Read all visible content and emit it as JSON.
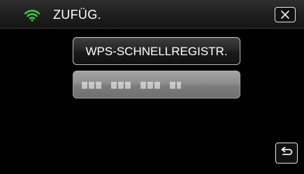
{
  "header": {
    "title": "ZUFÜG.",
    "wifi_icon": "wifi-icon",
    "wifi_color": "#3cc83c",
    "close_icon": "close-icon"
  },
  "main": {
    "wps_button_label": "WPS-SCHNELLREGISTR.",
    "pin_button_label": "",
    "pin_button_state": "disabled"
  },
  "footer": {
    "back_icon": "return-arrow-icon"
  },
  "colors": {
    "background": "#000000",
    "header_background": "#1d1d1d",
    "button_border": "#bdbdbd",
    "disabled_button": "#8e8e8e"
  }
}
